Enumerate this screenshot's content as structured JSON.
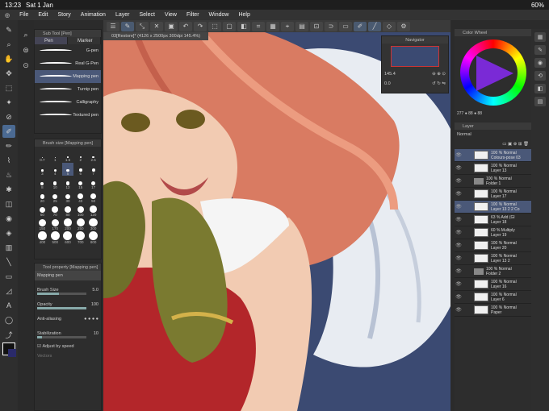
{
  "status": {
    "time": "13:23",
    "date": "Sat 1 Jan",
    "battery": "60%"
  },
  "menu": [
    "File",
    "Edit",
    "Story",
    "Animation",
    "Layer",
    "Select",
    "View",
    "Filter",
    "Window",
    "Help"
  ],
  "document_tab": "03[Restore]* (4126 x 2500px 300dpi 145.4%)",
  "subtool": {
    "title": "Sub Tool [Pen]",
    "tabs": [
      "Pen",
      "Marker"
    ],
    "brushes": [
      "G-pen",
      "Real G-Pen",
      "Mapping pen",
      "Turnip pen",
      "Calligraphy",
      "Textured pen"
    ],
    "selected_brush": "Mapping pen"
  },
  "brush_size": {
    "title": "Brush size [Mapping pen]",
    "sizes": [
      "0.7",
      "1",
      "1.5",
      "2",
      "2.5",
      "3",
      "4",
      "5",
      "6",
      "7",
      "8",
      "10",
      "12",
      "15",
      "17",
      "20",
      "25",
      "30",
      "40",
      "50",
      "60",
      "70",
      "80",
      "100",
      "120",
      "150",
      "170",
      "200",
      "250",
      "300",
      "400",
      "500",
      "600",
      "700",
      "800"
    ],
    "selected": "5"
  },
  "tool_property": {
    "title": "Tool property [Mapping pen]",
    "tool_name": "Mapping pen",
    "brush_size_label": "Brush Size",
    "brush_size_value": "5.0",
    "opacity_label": "Opacity",
    "opacity_value": "100",
    "antialiasing_label": "Anti-aliasing",
    "stabilization_label": "Stabilization",
    "stabilization_value": "10",
    "adjust_speed_label": "Adjust by speed",
    "vectors_label": "Vectors"
  },
  "navigator": {
    "title": "Navigator",
    "zoom": "145.4",
    "rotation": "0.0"
  },
  "color_wheel": {
    "title": "Color Wheel",
    "readout": "277 ● 88 ● 88"
  },
  "layer_panel": {
    "title": "Layer",
    "blend": "Normal",
    "layers": [
      {
        "opacity": "100 %",
        "mode": "Normal",
        "name": "Colours-pose 03",
        "type": "raster",
        "selected": true
      },
      {
        "opacity": "100 %",
        "mode": "Normal",
        "name": "Layer 13",
        "type": "raster",
        "selected": false
      },
      {
        "opacity": "100 %",
        "mode": "Normal",
        "name": "Folder 1",
        "type": "folder",
        "selected": false
      },
      {
        "opacity": "100 %",
        "mode": "Normal",
        "name": "Layer 17",
        "type": "raster",
        "selected": false
      },
      {
        "opacity": "100 %",
        "mode": "Normal",
        "name": "Layer 13 2 2 Co",
        "type": "raster",
        "selected": true
      },
      {
        "opacity": "63 %",
        "mode": "Add (Gl",
        "name": "Layer 18",
        "type": "raster",
        "selected": false
      },
      {
        "opacity": "60 %",
        "mode": "Multiply",
        "name": "Layer 19",
        "type": "raster",
        "selected": false
      },
      {
        "opacity": "100 %",
        "mode": "Normal",
        "name": "Layer 20",
        "type": "raster",
        "selected": false
      },
      {
        "opacity": "100 %",
        "mode": "Normal",
        "name": "Layer 13 2",
        "type": "raster",
        "selected": false
      },
      {
        "opacity": "100 %",
        "mode": "Normal",
        "name": "Folder 2",
        "type": "folder",
        "selected": false
      },
      {
        "opacity": "100 %",
        "mode": "Normal",
        "name": "Layer 16",
        "type": "raster",
        "selected": false
      },
      {
        "opacity": "100 %",
        "mode": "Normal",
        "name": "Layer 6",
        "type": "raster",
        "selected": false
      },
      {
        "opacity": "100 %",
        "mode": "Normal",
        "name": "Paper",
        "type": "raster",
        "selected": false
      }
    ]
  }
}
